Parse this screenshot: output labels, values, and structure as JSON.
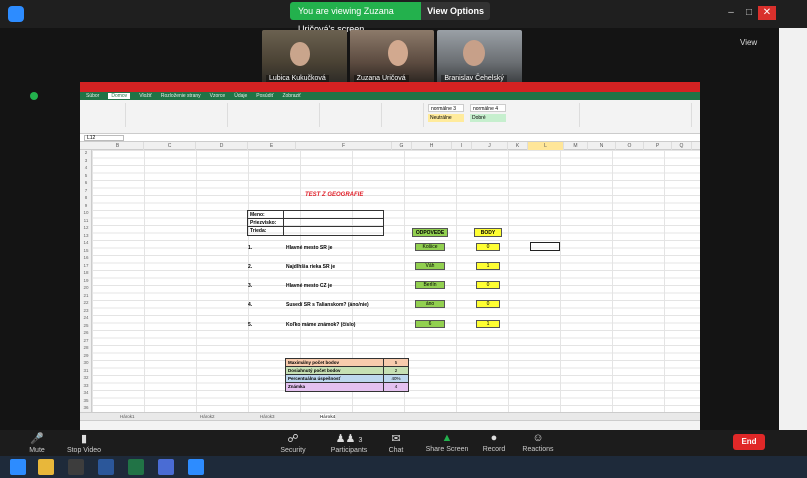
{
  "zoom": {
    "share_banner": "You are viewing Zuzana Uričová's screen",
    "view_options": "View Options",
    "view_label": "View",
    "participants": [
      {
        "name": "Lubica Kukučková"
      },
      {
        "name": "Zuzana Uričová"
      },
      {
        "name": "Branislav Čehelský"
      }
    ],
    "toolbar": [
      {
        "label": "Mute",
        "icon": "microphone-icon"
      },
      {
        "label": "Stop Video",
        "icon": "video-camera-icon"
      },
      {
        "label": "Security",
        "icon": "shield-icon"
      },
      {
        "label": "Participants",
        "icon": "participants-icon"
      },
      {
        "label": "Chat",
        "icon": "chat-icon"
      },
      {
        "label": "Share Screen",
        "icon": "share-screen-icon"
      },
      {
        "label": "Record",
        "icon": "record-icon"
      },
      {
        "label": "Reactions",
        "icon": "reactions-icon"
      }
    ],
    "participants_count": "3",
    "end_label": "End"
  },
  "excel": {
    "ribbon_tabs": [
      "Súbor",
      "Domov",
      "Vložiť",
      "Rozloženie strany",
      "Vzorce",
      "Údaje",
      "Posúdiť",
      "Zobraziť"
    ],
    "name_box": "L12",
    "columns": [
      "B",
      "C",
      "D",
      "E",
      "F",
      "G",
      "H",
      "I",
      "J",
      "K",
      "L",
      "M",
      "N",
      "O",
      "P",
      "Q"
    ],
    "styles": [
      "normálne 3",
      "normálne 4",
      "Neutrálne",
      "Dobré"
    ],
    "doc_title": "TEST Z GEOGRAFIE",
    "info_labels": [
      "Meno:",
      "Priezvisko:",
      "Trieda:"
    ],
    "header_answer": "ODPOVEDE",
    "header_points": "BODY",
    "questions": [
      {
        "num": "1.",
        "text": "Hlavné mesto SR je",
        "answer": "Košice",
        "points": "0"
      },
      {
        "num": "2.",
        "text": "Najdlhšia rieka SR je",
        "answer": "Váh",
        "points": "1"
      },
      {
        "num": "3.",
        "text": "Hlavné mesto CZ je",
        "answer": "Berlín",
        "points": "0"
      },
      {
        "num": "4.",
        "text": "Susedí SR s Talianskom? (áno/nie)",
        "answer": "áno",
        "points": "0"
      },
      {
        "num": "5.",
        "text": "Koľko máme známok? (číslo)",
        "answer": "6",
        "points": "1"
      }
    ],
    "summary": [
      {
        "label": "Maximálny počet bodov",
        "value": "5"
      },
      {
        "label": "Dosiahnutý počet bodov",
        "value": "2"
      },
      {
        "label": "Percentuálna úspešnosť",
        "value": "40%"
      },
      {
        "label": "Známka",
        "value": "4"
      }
    ],
    "sheet_tabs": [
      "Hárok1",
      "Hárok2",
      "Hárok3",
      "Hárok4"
    ]
  }
}
